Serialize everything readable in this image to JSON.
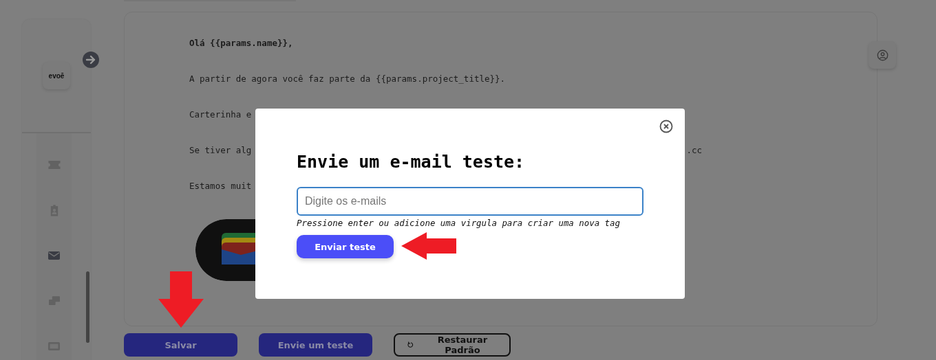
{
  "sidebar": {
    "logo": "evoē",
    "items": [
      {
        "kind": "ticket",
        "selected": false
      },
      {
        "kind": "badge",
        "selected": false
      },
      {
        "kind": "mail",
        "selected": true
      },
      {
        "kind": "cards",
        "selected": false
      },
      {
        "kind": "card",
        "selected": false
      }
    ]
  },
  "email_body": {
    "lines": [
      {
        "text": "Olá {{params.name}},",
        "bold": true
      },
      {
        "text": "A partir de agora você faz parte da {{params.project_title}}.",
        "bold": false
      },
      {
        "text": "Carterinha e",
        "bold": false
      },
      {
        "text": "Se tiver alg",
        "tail": ".cc",
        "bold": false
      },
      {
        "text": "Estamos muit",
        "bold": false
      }
    ]
  },
  "actions": [
    {
      "label": "Salvar",
      "kind": "primary"
    },
    {
      "label": "Envie um teste",
      "kind": "primary"
    },
    {
      "label": "Restaurar Padrão",
      "kind": "outline"
    }
  ],
  "modal": {
    "title": "Envie um e-mail teste:",
    "input": {
      "placeholder": "Digite os e-mails"
    },
    "hint": "Pressione enter ou adicione uma virgula para criar uma nova tag",
    "button": "Enviar teste"
  }
}
